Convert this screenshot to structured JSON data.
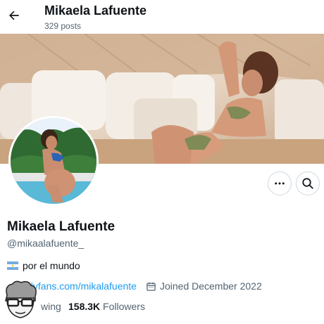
{
  "header": {
    "title": "Mikaela Lafuente",
    "post_count": "329 posts"
  },
  "profile": {
    "name": "Mikaela Lafuente",
    "handle": "@mikaalafuente_",
    "bio": "por el mundo",
    "bio_flag": "argentina-flag",
    "link": "nlyfans.com/mikalafuente",
    "joined": "Joined December 2022",
    "following_label": "wing",
    "followers_count": "158.3K",
    "followers_label": "Followers",
    "bottom_cut_text": "— . . .   . .   . . . . .   . . . ."
  },
  "colors": {
    "accent": "#1d9bf0",
    "secondary": "#536471",
    "text": "#0f1419",
    "border": "#cfd9de"
  },
  "icons": [
    "back-arrow-icon",
    "more-icon",
    "search-icon",
    "calendar-icon",
    "link-icon"
  ]
}
